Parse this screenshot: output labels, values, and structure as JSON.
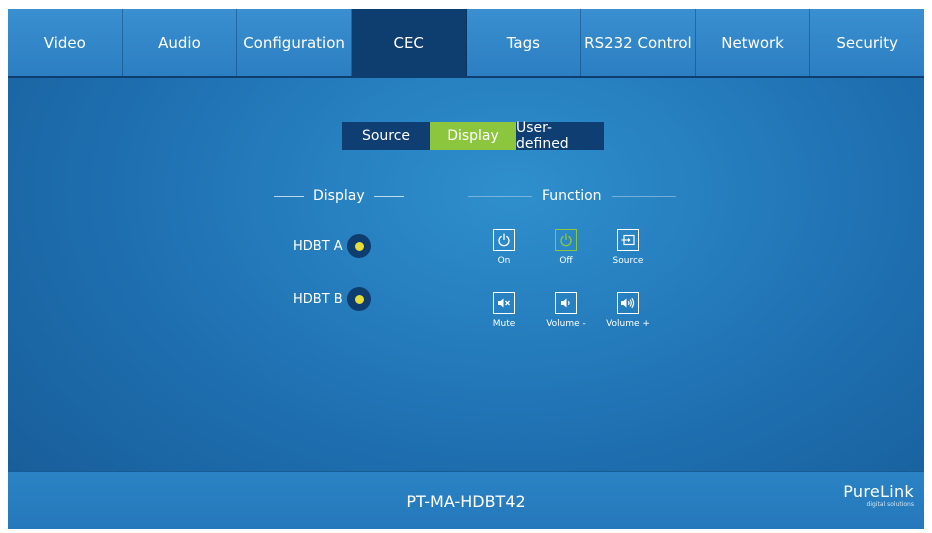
{
  "nav": {
    "tabs": [
      {
        "label": "Video",
        "active": false
      },
      {
        "label": "Audio",
        "active": false
      },
      {
        "label": "Configuration",
        "active": false
      },
      {
        "label": "CEC",
        "active": true
      },
      {
        "label": "Tags",
        "active": false
      },
      {
        "label": "RS232 Control",
        "active": false
      },
      {
        "label": "Network",
        "active": false
      },
      {
        "label": "Security",
        "active": false
      }
    ]
  },
  "subtabs": [
    {
      "label": "Source",
      "active": false
    },
    {
      "label": "Display",
      "active": true
    },
    {
      "label": "User-defined",
      "active": false
    }
  ],
  "display_section": {
    "title": "Display",
    "items": [
      {
        "label": "HDBT A"
      },
      {
        "label": "HDBT B"
      }
    ]
  },
  "function_section": {
    "title": "Function",
    "buttons": [
      {
        "label": "On",
        "icon": "power-icon",
        "active": false
      },
      {
        "label": "Off",
        "icon": "power-icon",
        "active": true
      },
      {
        "label": "Source",
        "icon": "source-input-icon",
        "active": false
      },
      {
        "label": "Mute",
        "icon": "mute-icon",
        "active": false
      },
      {
        "label": "Volume -",
        "icon": "volume-down-icon",
        "active": false
      },
      {
        "label": "Volume +",
        "icon": "volume-up-icon",
        "active": false
      }
    ]
  },
  "footer": {
    "model": "PT-MA-HDBT42",
    "logo": "PureLink",
    "logo_tagline": "digital solutions"
  },
  "colors": {
    "background": "#1e6fb0",
    "nav_active": "#0e3d70",
    "accent_green": "#8cc63e",
    "indicator_yellow": "#e7dd3a"
  }
}
